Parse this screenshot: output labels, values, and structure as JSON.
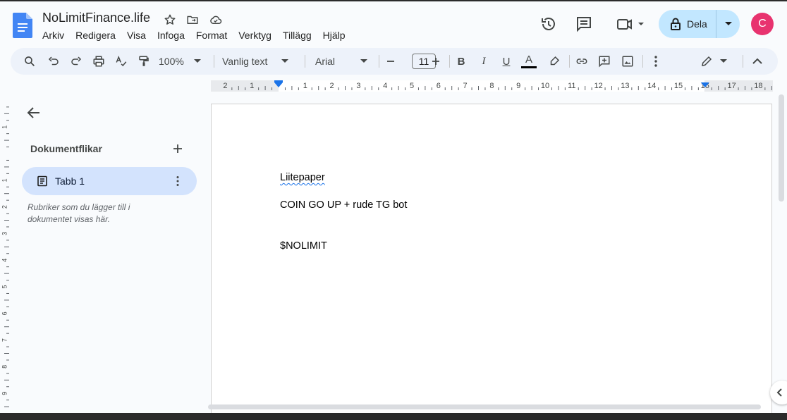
{
  "header": {
    "doc_title": "NoLimitFinance.life",
    "menu": [
      "Arkiv",
      "Redigera",
      "Visa",
      "Infoga",
      "Format",
      "Verktyg",
      "Tillägg",
      "Hjälp"
    ],
    "share_label": "Dela",
    "avatar_letter": "C",
    "icons": [
      "star-icon",
      "move-folder-icon",
      "cloud-saved-icon",
      "history-icon",
      "comments-icon",
      "meet-icon"
    ]
  },
  "toolbar": {
    "zoom": "100%",
    "style": "Vanlig text",
    "font": "Arial",
    "font_size": "11",
    "bold": "B",
    "italic": "I",
    "underline": "U",
    "text_color": "A"
  },
  "ruler": {
    "labels": [
      "2",
      "1",
      "1",
      "2",
      "3",
      "4",
      "5",
      "6",
      "7",
      "8",
      "9",
      "10",
      "11",
      "12",
      "13",
      "14",
      "15",
      "16",
      "17",
      "18"
    ],
    "vlabels": [
      "2",
      "1",
      "1",
      "2",
      "3",
      "4",
      "5",
      "6",
      "7",
      "8",
      "9"
    ]
  },
  "sidebar": {
    "title": "Dokumentflikar",
    "tab_label": "Tabb 1",
    "hint": "Rubriker som du lägger till i dokumentet visas här."
  },
  "document": {
    "line1": "Liitepaper",
    "line2": "COIN GO UP + rude TG bot",
    "line3": "$NOLIMIT"
  },
  "colors": {
    "accent": "#1a73e8",
    "share_bg": "#c2e7ff",
    "avatar_bg": "#e8336f",
    "tab_bg": "#d3e3fd"
  }
}
